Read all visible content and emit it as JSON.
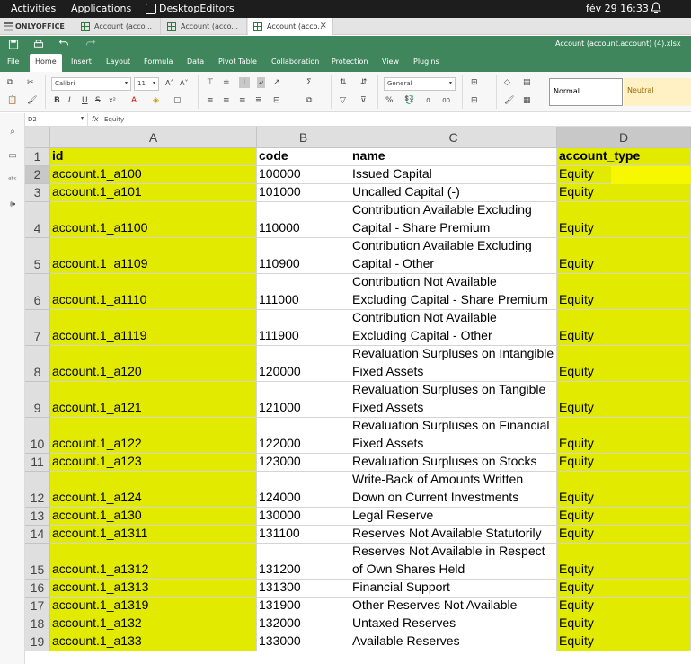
{
  "system_bar": {
    "activities": "Activities",
    "applications": "Applications",
    "app_name": "DesktopEditors",
    "clock": "fév 29  16:33"
  },
  "tabs": {
    "logo": "ONLYOFFICE",
    "items": [
      {
        "label": "Account (acco..."
      },
      {
        "label": "Account (acco..."
      },
      {
        "label": "Account (acco..."
      }
    ],
    "close": "×"
  },
  "header": {
    "doc_title": "Account (account.account) (4).xlsx",
    "menus": [
      "File",
      "Home",
      "Insert",
      "Layout",
      "Formula",
      "Data",
      "Pivot Table",
      "Collaboration",
      "Protection",
      "View",
      "Plugins"
    ],
    "active_menu": "Home"
  },
  "toolbar": {
    "font_name": "Calibri",
    "font_size": "11",
    "number_format": "General",
    "style_normal": "Normal",
    "style_neutral": "Neutral",
    "colors": {
      "neutral_bg": "#fff1c4",
      "neutral_fg": "#9c6500",
      "accent": "#40865c",
      "highlight": "#e2ea00"
    }
  },
  "formula_bar": {
    "cell_ref": "D2",
    "fx": "fx",
    "value": "Equity"
  },
  "grid": {
    "columns": [
      "A",
      "B",
      "C",
      "D"
    ],
    "selected_column": "D",
    "selected_row": "2",
    "rows": [
      {
        "num": "1",
        "id": "id",
        "code": "code",
        "name": "name",
        "type": "account_type"
      },
      {
        "num": "2",
        "id": "account.1_a100",
        "code": "100000",
        "name": "Issued Capital",
        "type": "Equity"
      },
      {
        "num": "3",
        "id": "account.1_a101",
        "code": "101000",
        "name": "Uncalled Capital (-)",
        "type": "Equity"
      },
      {
        "num": "4",
        "id": "account.1_a1100",
        "code": "110000",
        "name": "Contribution Available Excluding Capital - Share Premium",
        "type": "Equity"
      },
      {
        "num": "5",
        "id": "account.1_a1109",
        "code": "110900",
        "name": "Contribution Available Excluding Capital - Other",
        "type": "Equity"
      },
      {
        "num": "6",
        "id": "account.1_a1110",
        "code": "111000",
        "name": "Contribution Not Available Excluding Capital - Share Premium",
        "type": "Equity"
      },
      {
        "num": "7",
        "id": "account.1_a1119",
        "code": "111900",
        "name": "Contribution Not Available Excluding Capital - Other",
        "type": "Equity"
      },
      {
        "num": "8",
        "id": "account.1_a120",
        "code": "120000",
        "name": "Revaluation Surpluses on Intangible Fixed Assets",
        "type": "Equity"
      },
      {
        "num": "9",
        "id": "account.1_a121",
        "code": "121000",
        "name": "Revaluation Surpluses on Tangible Fixed Assets",
        "type": "Equity"
      },
      {
        "num": "10",
        "id": "account.1_a122",
        "code": "122000",
        "name": "Revaluation Surpluses on Financial Fixed Assets",
        "type": "Equity"
      },
      {
        "num": "11",
        "id": "account.1_a123",
        "code": "123000",
        "name": "Revaluation Surpluses on Stocks",
        "type": "Equity"
      },
      {
        "num": "12",
        "id": "account.1_a124",
        "code": "124000",
        "name": "Write-Back of Amounts Written Down on Current Investments",
        "type": "Equity"
      },
      {
        "num": "13",
        "id": "account.1_a130",
        "code": "130000",
        "name": "Legal Reserve",
        "type": "Equity"
      },
      {
        "num": "14",
        "id": "account.1_a1311",
        "code": "131100",
        "name": "Reserves Not Available Statutorily",
        "type": "Equity"
      },
      {
        "num": "15",
        "id": "account.1_a1312",
        "code": "131200",
        "name": "Reserves Not Available in Respect of Own Shares Held",
        "type": "Equity"
      },
      {
        "num": "16",
        "id": "account.1_a1313",
        "code": "131300",
        "name": "Financial Support",
        "type": "Equity"
      },
      {
        "num": "17",
        "id": "account.1_a1319",
        "code": "131900",
        "name": "Other Reserves Not Available",
        "type": "Equity"
      },
      {
        "num": "18",
        "id": "account.1_a132",
        "code": "132000",
        "name": "Untaxed Reserves",
        "type": "Equity"
      },
      {
        "num": "19",
        "id": "account.1_a133",
        "code": "133000",
        "name": "Available Reserves",
        "type": "Equity"
      }
    ]
  }
}
